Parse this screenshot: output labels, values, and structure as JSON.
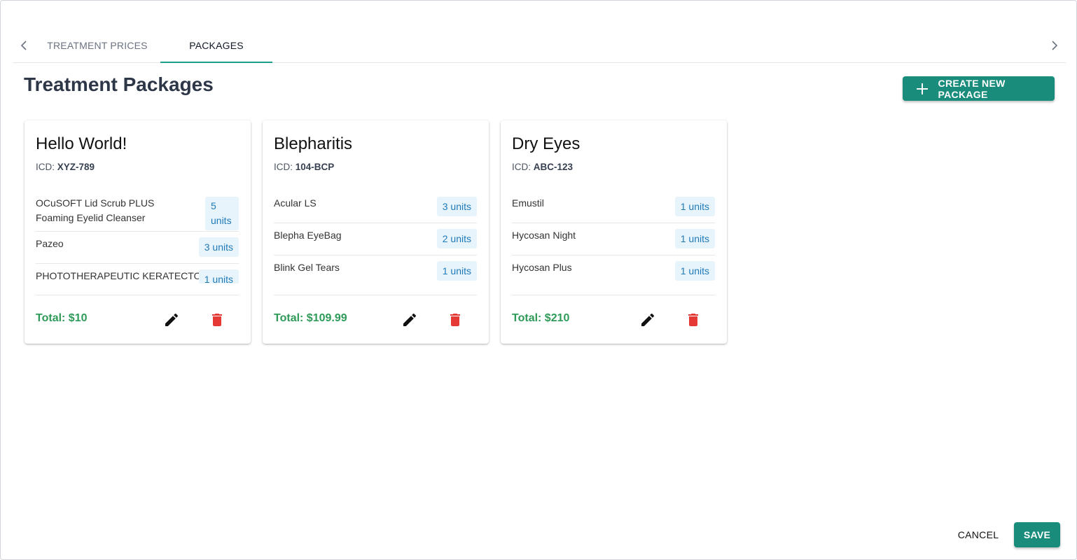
{
  "tabs": {
    "items": [
      {
        "label": "TREATMENT PRICES"
      },
      {
        "label": "PACKAGES"
      }
    ],
    "active": "PACKAGES"
  },
  "header": {
    "title": "Treatment Packages",
    "create_label": "CREATE NEW PACKAGE"
  },
  "packages": [
    {
      "name": "Hello World!",
      "icd_label": "ICD:",
      "icd": "XYZ-789",
      "items": [
        {
          "name": "OCuSOFT Lid Scrub PLUS Foaming Eyelid Cleanser",
          "units": "5 units"
        },
        {
          "name": "Pazeo",
          "units": "3 units"
        },
        {
          "name": "PHOTOTHERAPEUTIC KERATECTOMY",
          "units": "1 units"
        }
      ],
      "total": "Total: $10"
    },
    {
      "name": "Blepharitis",
      "icd_label": "ICD:",
      "icd": "104-BCP",
      "items": [
        {
          "name": "Acular LS",
          "units": "3 units"
        },
        {
          "name": "Blepha EyeBag",
          "units": "2 units"
        },
        {
          "name": "Blink Gel Tears",
          "units": "1 units"
        }
      ],
      "total": "Total: $109.99"
    },
    {
      "name": "Dry Eyes",
      "icd_label": "ICD:",
      "icd": "ABC-123",
      "items": [
        {
          "name": "Emustil",
          "units": "1 units"
        },
        {
          "name": "Hycosan Night",
          "units": "1 units"
        },
        {
          "name": "Hycosan Plus",
          "units": "1 units"
        }
      ],
      "total": "Total: $210"
    }
  ],
  "footer": {
    "cancel_label": "CANCEL",
    "save_label": "SAVE"
  },
  "colors": {
    "accent": "#1a8c7c",
    "total_green": "#2e9b58",
    "delete_red": "#e53935",
    "badge_bg": "#e8f4fb",
    "badge_text": "#1f7ab8"
  },
  "icons": {
    "tab_prev": "chevron-left-icon",
    "tab_next": "chevron-right-icon",
    "create": "plus-icon",
    "edit": "pencil-icon",
    "delete": "trash-icon"
  }
}
